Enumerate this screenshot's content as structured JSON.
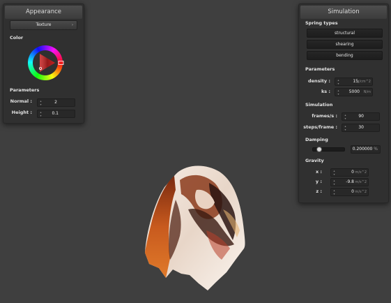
{
  "appearance": {
    "title": "Appearance",
    "texture_dropdown": "Texture",
    "color_label": "Color",
    "params_label": "Parameters",
    "normal_label": "Normal :",
    "normal_value": "2",
    "height_label": "Height :",
    "height_value": "0.1",
    "selected_color": "#d42020"
  },
  "simulation": {
    "title": "Simulation",
    "spring_types_label": "Spring types",
    "spring_buttons": [
      "structural",
      "shearing",
      "bending"
    ],
    "parameters_label": "Parameters",
    "density_label": "density :",
    "density_value": "15",
    "density_unit": "g/cm^2",
    "ks_label": "ks :",
    "ks_value": "5000",
    "ks_unit": "N/m",
    "simulation_label": "Simulation",
    "fps_label": "frames/s :",
    "fps_value": "90",
    "steps_label": "steps/frame :",
    "steps_value": "30",
    "damping_label": "Damping",
    "damping_value": "0.200000",
    "damping_unit": "%",
    "damping_fraction": 0.2,
    "gravity_label": "Gravity",
    "gx_label": "x :",
    "gx_value": "0",
    "gy_label": "y :",
    "gy_value": "-9.8",
    "gz_label": "z :",
    "gz_value": "0",
    "gravity_unit": "m/s^2"
  }
}
